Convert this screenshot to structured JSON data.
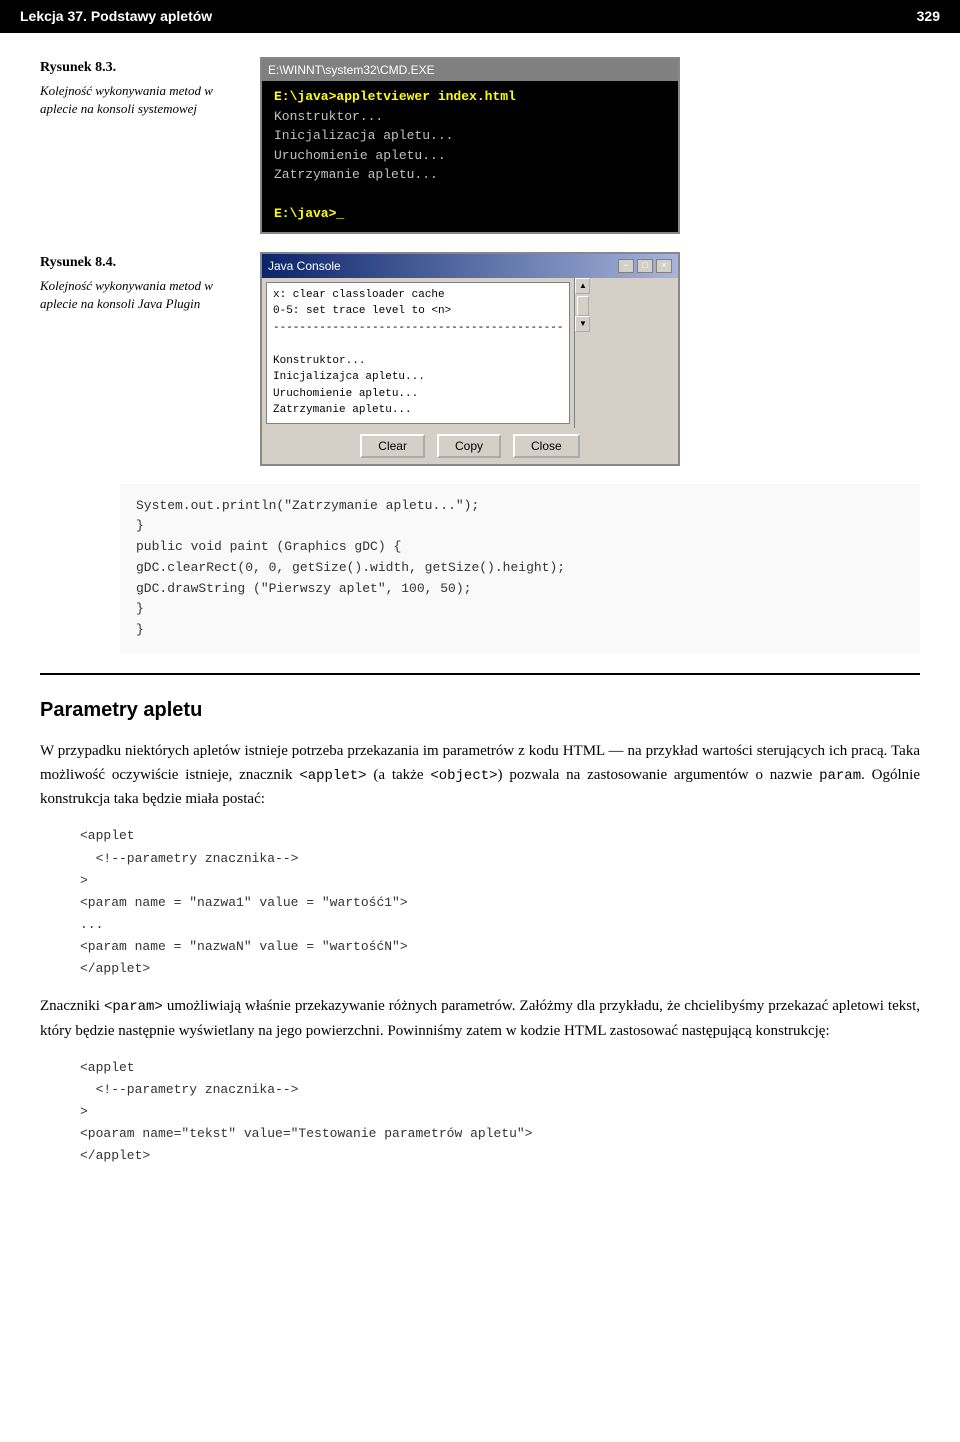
{
  "header": {
    "lesson_title": "Lekcja 37. Podstawy apletów",
    "page_number": "329"
  },
  "figure1": {
    "label": "Rysunek 8.3.",
    "description": "Kolejność wykonywania metod w aplecie na konsoli systemowej",
    "cmd": {
      "titlebar": "E:\\WINNT\\system32\\CMD.EXE",
      "lines": [
        "E:\\java>appletviewer index.html",
        "Konstruktor...",
        "Inicjalizacja apletu...",
        "Uruchomienie apletu...",
        "Zatrzymanie apletu...",
        "",
        "E:\\java>_"
      ]
    }
  },
  "figure2": {
    "label": "Rysunek 8.4.",
    "description": "Kolejność wykonywania metod w aplecie na konsoli Java Plugin",
    "java_console": {
      "titlebar": "Java Console",
      "win_buttons": [
        "-",
        "□",
        "×"
      ],
      "body_lines": [
        "x:  clear classloader cache",
        "0-5: set trace level to <n>",
        "--------------------------------------------",
        "",
        "Konstruktor...",
        "Inicjalizajca apletu...",
        "Uruchomienie apletu...",
        "Zatrzymanie apletu..."
      ],
      "buttons": [
        "Clear",
        "Copy",
        "Close"
      ]
    }
  },
  "code_block": {
    "lines": [
      "    System.out.println(\"Zatrzymanie apletu...\");",
      "  }",
      "  public void paint (Graphics gDC) {",
      "    gDC.clearRect(0, 0, getSize().width, getSize().height);",
      "    gDC.drawString (\"Pierwszy aplet\", 100, 50);",
      "  }",
      "}"
    ]
  },
  "section": {
    "heading": "Parametry apletu",
    "paragraphs": [
      "W przypadku niektórych apletów istnieje potrzeba przekazania im parametrów z kodu HTML — na przykład wartości sterujących ich pracą. Taka możliwość oczywiście istnieje, znacznik <applet> (a także <object>) pozwala na zastosowanie argumentów o nazwie param. Ogólnie konstrukcja taka będzie miała postać:"
    ],
    "code1": [
      "<applet",
      "  <!--parametry znacznika-->",
      ">",
      "<param name = \"nazwa1\" value = \"wartość1\">",
      "...",
      "<param name = \"nazwaN\" value = \"wartośćN\">",
      "</applet>"
    ],
    "paragraph2": "Znaczniki <param> umożliwiają właśnie przekazywanie różnych parametrów. Załóżmy dla przykładu, że chcielibyśmy przekazać apletowi tekst, który będzie następnie wyświetlany na jego powierzchni. Powinniśmy zatem w kodzie HTML zastosować następującą konstrukcję:",
    "code2": [
      "<applet",
      "  <!--parametry znacznika-->",
      ">",
      "<poaram name=\"tekst\" value=\"Testowanie parametrów apletu\">",
      "</applet>"
    ]
  }
}
